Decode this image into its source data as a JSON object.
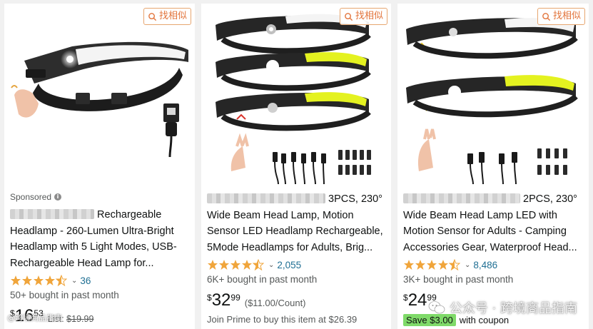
{
  "similar_button_label": "找相似",
  "products": [
    {
      "sponsored_label": "Sponsored",
      "title_visible": "Rechargeable Headlamp - 260-Lumen Ultra-Bright Headlamp with 5 Light Modes, USB-Rechargeable Head Lamp for...",
      "rating": 4.5,
      "review_count": "36",
      "bought": "50+ bought in past month",
      "price": {
        "currency": "$",
        "whole": "16",
        "fraction": "53"
      },
      "list_price": "$19.99",
      "list_label": "List:"
    },
    {
      "title_prefix": "3PCS, 230°",
      "title_visible": "Wide Beam Head Lamp, Motion Sensor LED Headlamp Rechargeable, 5Mode Headlamps for Adults, Brig...",
      "rating": 4.5,
      "review_count": "2,055",
      "bought": "6K+ bought in past month",
      "price": {
        "currency": "$",
        "whole": "32",
        "fraction": "99"
      },
      "per_unit": "($11.00/Count)",
      "prime_text": "Join Prime to buy this item at $26.39"
    },
    {
      "title_prefix": "2PCS, 230°",
      "title_visible": "Wide Beam Head Lamp LED with Motion Sensor for Adults - Camping Accessories Gear, Waterproof Head...",
      "rating": 4.5,
      "review_count": "8,486",
      "bought": "3K+ bought in past month",
      "price": {
        "currency": "$",
        "whole": "24",
        "fraction": "99"
      },
      "coupon_badge": "Save $3.00",
      "coupon_text": "with coupon"
    }
  ],
  "watermark": "公众号 · 跨境商品指南",
  "watermark_small": "@跨境商品指南",
  "colors": {
    "star": "#f0a53b",
    "link": "#1f6f93",
    "coupon": "#7fda69",
    "similar": "#e2733a",
    "beam_yellow": "#e4f220"
  }
}
